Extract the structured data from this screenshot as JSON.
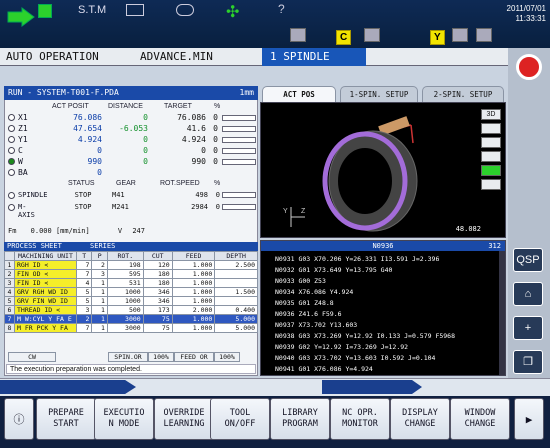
{
  "topbar": {
    "mode_label": "S.T.M",
    "badge_c": "C",
    "badge_y": "Y",
    "clock_date": "2011/07/01",
    "clock_time": "11:33:31"
  },
  "modebar": {
    "left": "AUTO OPERATION",
    "center": "ADVANCE.MIN",
    "spindle": "1 SPINDLE"
  },
  "program": {
    "title": "RUN - SYSTEM-T001-F.PDA",
    "unit": "1mm"
  },
  "axis_headers": [
    "ACT POSIT",
    "DISTANCE",
    "TARGET",
    "%"
  ],
  "axes": [
    {
      "name": "X1",
      "act": "76.086",
      "dist": "0",
      "target": "76.086",
      "pct": "0",
      "sel": false
    },
    {
      "name": "Z1",
      "act": "47.654",
      "dist": "-6.053",
      "target": "41.6",
      "pct": "0",
      "sel": false
    },
    {
      "name": "Y1",
      "act": "4.924",
      "dist": "0",
      "target": "4.924",
      "pct": "0",
      "sel": false
    },
    {
      "name": "C",
      "act": "0",
      "dist": "0",
      "target": "0",
      "pct": "0",
      "sel": false
    },
    {
      "name": "W",
      "act": "990",
      "dist": "0",
      "target": "990",
      "pct": "0",
      "sel": true
    },
    {
      "name": "BA",
      "act": "0",
      "dist": "",
      "target": "",
      "pct": "",
      "sel": false
    }
  ],
  "spindle_headers": [
    "STATUS",
    "GEAR",
    "ROT.SPEED",
    "%"
  ],
  "spindles": [
    {
      "name": "SPINDLE",
      "status": "STOP",
      "gear": "M41",
      "speed": "498",
      "pct": "0"
    },
    {
      "name": "M-AXIS",
      "status": "STOP",
      "gear": "M241",
      "speed": "2984",
      "pct": "0"
    }
  ],
  "feed": {
    "label": "Fm",
    "value": "0.000",
    "unit": "[mm/min]",
    "v_label": "V",
    "v_value": "247"
  },
  "process_sheet": {
    "title": "PROCESS SHEET",
    "series_label": "SERIES",
    "headers": [
      "MACHINING UNIT",
      "T",
      "P",
      "ROT.",
      "CUT",
      "FEED",
      "DEPTH"
    ],
    "rows": [
      {
        "no": "1",
        "unit": "RGH ID <",
        "t": "7",
        "p": "2",
        "rot": "198",
        "cut": "120",
        "feed": "1.000",
        "depth": "2.500"
      },
      {
        "no": "2",
        "unit": "FIN OD <",
        "t": "7",
        "p": "3",
        "rot": "595",
        "cut": "180",
        "feed": "1.000",
        "depth": ""
      },
      {
        "no": "3",
        "unit": "FIN ID <",
        "t": "4",
        "p": "1",
        "rot": "531",
        "cut": "180",
        "feed": "1.000",
        "depth": ""
      },
      {
        "no": "4",
        "unit": "GRV RGH WD ID",
        "t": "5",
        "p": "1",
        "rot": "1000",
        "cut": "346",
        "feed": "1.000",
        "depth": "1.500"
      },
      {
        "no": "5",
        "unit": "GRV FIN WD ID",
        "t": "5",
        "p": "1",
        "rot": "1000",
        "cut": "346",
        "feed": "1.000",
        "depth": ""
      },
      {
        "no": "6",
        "unit": "THREAD ID <",
        "t": "3",
        "p": "1",
        "rot": "500",
        "cut": "173",
        "feed": "2.000",
        "depth": "0.400"
      },
      {
        "no": "7",
        "unit": "M W:CYL Y FA E",
        "t": "2",
        "p": "1",
        "rot": "3000",
        "cut": "75",
        "feed": "1.000",
        "depth": "5.000"
      },
      {
        "no": "8",
        "unit": "M FR PCK Y FA",
        "t": "7",
        "p": "1",
        "rot": "3000",
        "cut": "75",
        "feed": "1.000",
        "depth": "5.000"
      }
    ],
    "selected_row": 6
  },
  "status_fields": [
    "CW",
    "SPIN.OR",
    "100%",
    "FEED OR",
    "100%"
  ],
  "message": "The execution preparation was completed.",
  "tabs": [
    "ACT POS",
    "1-SPIN. SETUP",
    "2-SPIN. SETUP"
  ],
  "viewer": {
    "mode_3d": "3D",
    "readout": "48.082"
  },
  "nc": {
    "program_no": "N0936",
    "line_count": "312",
    "lines": [
      "N0931 G03 X70.206 Y=26.331 I13.591 J=2.396",
      "N0932 G01 X73.649 Y=13.795 G40",
      "N0933 G00 Z53",
      "N0934 X76.086 Y4.924",
      "N0935 G01 Z48.8",
      "N0936 Z41.6 F59.6",
      "N0937 X73.702 Y13.603",
      "N0938 G03 X73.269 Y=12.92 I0.133 J=0.579 F5968",
      "N0939 G02 Y=12.92 I=73.269 J=12.92",
      "N0940 G03 X73.702 Y=13.603 I0.592 J=0.104",
      "N0941 G01 X76.086 Y=4.924"
    ]
  },
  "right_buttons": [
    "QSP",
    "⌂",
    "+",
    "❐"
  ],
  "function_keys": [
    "PREPARE\nSTART",
    "EXECUTIO\nN MODE",
    "OVERRIDE\nLEARNING",
    "TOOL\nON/OFF",
    "LIBRARY\nPROGRAM",
    "NC OPR.\nMONITOR",
    "DISPLAY\nCHANGE",
    "WINDOW\nCHANGE"
  ]
}
